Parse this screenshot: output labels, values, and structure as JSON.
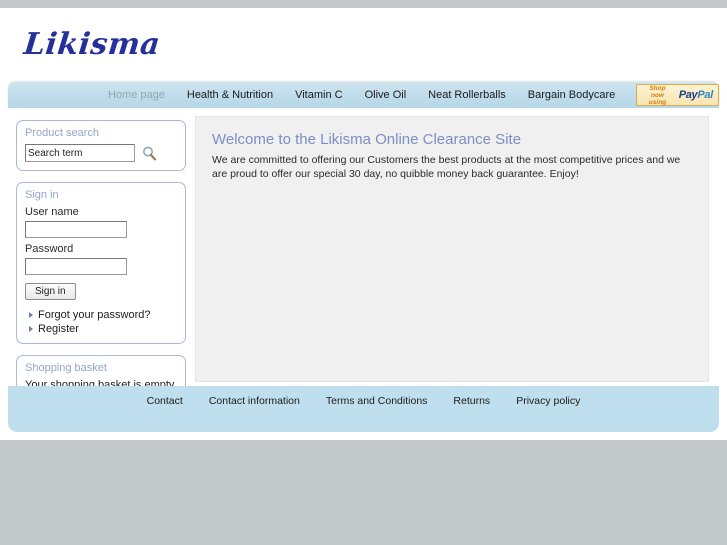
{
  "site": {
    "logo_text": "Likisma"
  },
  "nav": {
    "items": [
      {
        "label": "Home page",
        "current": true
      },
      {
        "label": "Health & Nutrition",
        "current": false
      },
      {
        "label": "Vitamin C",
        "current": false
      },
      {
        "label": "Olive Oil",
        "current": false
      },
      {
        "label": "Neat Rollerballs",
        "current": false
      },
      {
        "label": "Bargain Bodycare",
        "current": false
      }
    ],
    "paypal": {
      "line1": "Shop now",
      "line2": "using",
      "brand_pay": "Pay",
      "brand_pal": "Pal"
    }
  },
  "sidebar": {
    "search_panel": {
      "title": "Product search",
      "input_value": "Search term",
      "input_placeholder": "Search term",
      "icon": "magnifier-icon"
    },
    "signin_panel": {
      "title": "Sign in",
      "username_label": "User name",
      "username_value": "",
      "password_label": "Password",
      "password_value": "",
      "submit_label": "Sign in",
      "links": [
        "Forgot your password?",
        "Register"
      ]
    },
    "basket_panel": {
      "title": "Shopping basket",
      "message": "Your shopping basket is empty."
    },
    "contact_link": "Contact information"
  },
  "main": {
    "heading": "Welcome to the Likisma Online Clearance Site",
    "paragraph": "We are committed to offering our Customers the best products at the most competitive prices and we are proud to offer our special 30 day, no quibble money back guarantee. Enjoy!"
  },
  "footer": {
    "links": [
      "Contact",
      "Contact information",
      "Terms and Conditions",
      "Returns",
      "Privacy policy"
    ]
  },
  "colors": {
    "nav_bar": "#bfdceb",
    "footer_bar": "#bfdfee",
    "panel_border": "#aab8dd",
    "panel_title": "#94a4cd",
    "heading": "#7b8fc4",
    "logo": "#25309b",
    "page_background": "#c4c9cb",
    "content_background": "#f0f0f0",
    "paypal_orange": "#d77b10",
    "paypal_blue": "#1d3e86"
  }
}
